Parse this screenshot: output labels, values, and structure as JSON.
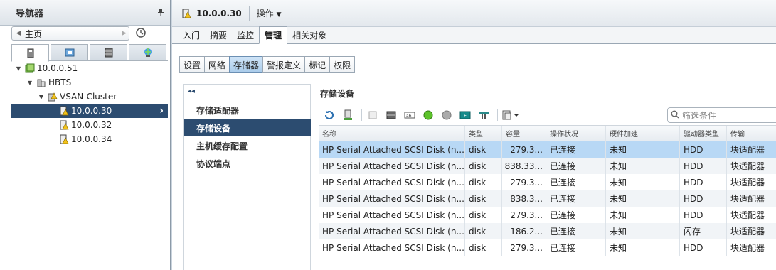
{
  "navigator": {
    "title": "导航器",
    "home_label": "主页",
    "tree": [
      {
        "label": "10.0.0.51",
        "level": 0
      },
      {
        "label": "HBTS",
        "level": 1
      },
      {
        "label": "VSAN-Cluster",
        "level": 2
      },
      {
        "label": "10.0.0.30",
        "level": 3,
        "selected": true
      },
      {
        "label": "10.0.0.32",
        "level": 3
      },
      {
        "label": "10.0.0.34",
        "level": 3
      }
    ]
  },
  "header": {
    "title": "10.0.0.30",
    "actions_label": "操作"
  },
  "main_tabs": [
    "入门",
    "摘要",
    "监控",
    "管理",
    "相关对象"
  ],
  "sub_tabs": [
    "设置",
    "网络",
    "存储器",
    "警报定义",
    "标记",
    "权限"
  ],
  "side_menu": [
    "存储适配器",
    "存储设备",
    "主机缓存配置",
    "协议端点"
  ],
  "section": {
    "title": "存储设备",
    "filter_placeholder": "筛选条件"
  },
  "table": {
    "columns": [
      "名称",
      "类型",
      "容量",
      "操作状况",
      "硬件加速",
      "驱动器类型",
      "传输"
    ],
    "rows": [
      [
        "HP Serial Attached SCSI Disk (n...",
        "disk",
        "279.3...",
        "已连接",
        "未知",
        "HDD",
        "块适配器"
      ],
      [
        "HP Serial Attached SCSI Disk (n...",
        "disk",
        "838.33...",
        "已连接",
        "未知",
        "HDD",
        "块适配器"
      ],
      [
        "HP Serial Attached SCSI Disk (n...",
        "disk",
        "279.3...",
        "已连接",
        "未知",
        "HDD",
        "块适配器"
      ],
      [
        "HP Serial Attached SCSI Disk (n...",
        "disk",
        "838.3...",
        "已连接",
        "未知",
        "HDD",
        "块适配器"
      ],
      [
        "HP Serial Attached SCSI Disk (n...",
        "disk",
        "279.3...",
        "已连接",
        "未知",
        "HDD",
        "块适配器"
      ],
      [
        "HP Serial Attached SCSI Disk (n...",
        "disk",
        "186.2...",
        "已连接",
        "未知",
        "闪存",
        "块适配器"
      ],
      [
        "HP Serial Attached SCSI Disk (n...",
        "disk",
        "279.3...",
        "已连接",
        "未知",
        "HDD",
        "块适配器"
      ]
    ]
  },
  "colors": {
    "selection_dark": "#2c4c70",
    "row_selected": "#b8d8f5",
    "warning_yellow": "#f2c21b"
  }
}
